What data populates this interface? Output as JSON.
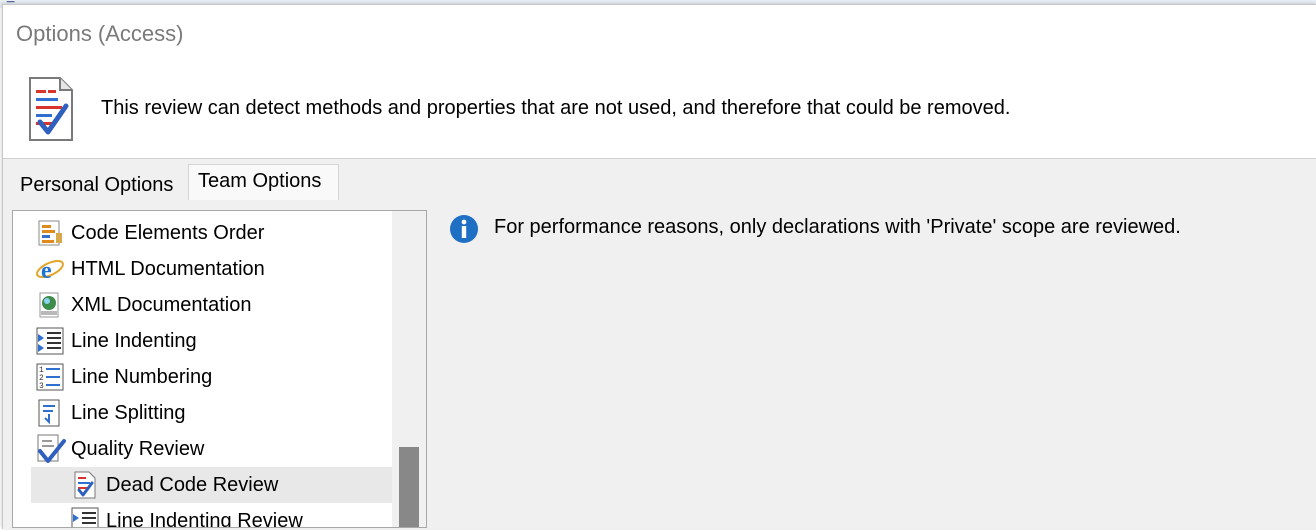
{
  "window": {
    "title": "Options (Access)"
  },
  "header": {
    "icon": "review-document-icon",
    "description": "This review can detect methods and properties that are not used, and therefore that could be removed."
  },
  "tabs": [
    {
      "label": "Personal Options",
      "active": false
    },
    {
      "label": "Team Options",
      "active": true
    }
  ],
  "tree": {
    "items": [
      {
        "label": "Code Elements Order",
        "icon": "code-order-icon",
        "level": 0
      },
      {
        "label": "HTML Documentation",
        "icon": "ie-icon",
        "level": 0
      },
      {
        "label": "XML Documentation",
        "icon": "xml-globe-icon",
        "level": 0
      },
      {
        "label": "Line Indenting",
        "icon": "indent-icon",
        "level": 0
      },
      {
        "label": "Line Numbering",
        "icon": "numbering-icon",
        "level": 0
      },
      {
        "label": "Line Splitting",
        "icon": "splitting-icon",
        "level": 0
      },
      {
        "label": "Quality Review",
        "icon": "quality-check-icon",
        "level": 0
      },
      {
        "label": "Dead Code Review",
        "icon": "review-document-icon",
        "level": 1,
        "selected": true
      },
      {
        "label": "Line Indenting Review",
        "icon": "indent-icon",
        "level": 1
      }
    ]
  },
  "info": {
    "icon": "info-icon",
    "message": "For performance reasons, only declarations with 'Private' scope are reviewed."
  },
  "colors": {
    "info_blue": "#1f6fc5",
    "selection": "#e8e8e8",
    "panel_bg": "#f0f0f0"
  }
}
